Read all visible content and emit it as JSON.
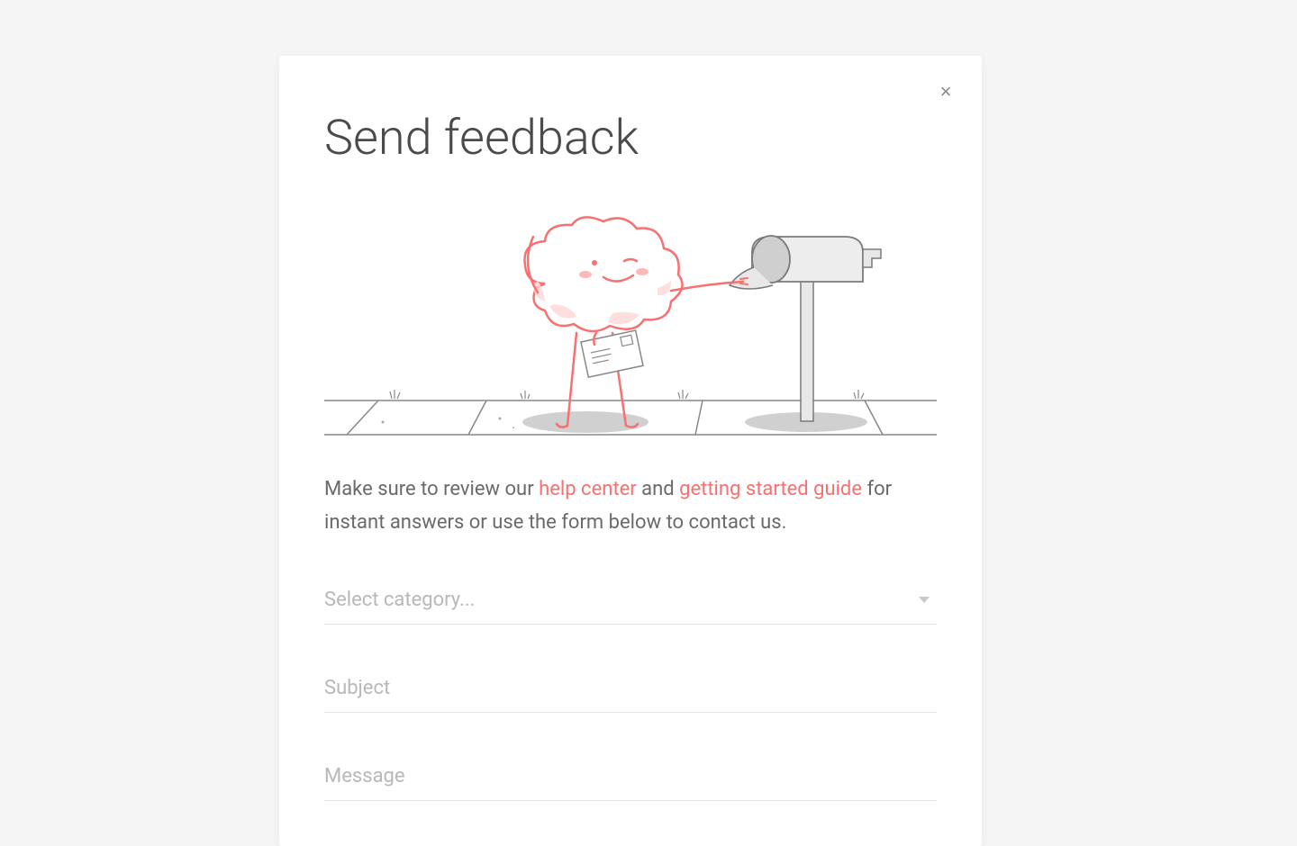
{
  "modal": {
    "title": "Send feedback",
    "description": {
      "pre": "Make sure to review our ",
      "link1": "help center",
      "middle": " and ",
      "link2": "getting started guide",
      "post": " for instant answers or use the form below to contact us."
    },
    "form": {
      "category_placeholder": "Select category...",
      "subject_placeholder": "Subject",
      "message_placeholder": "Message"
    }
  }
}
